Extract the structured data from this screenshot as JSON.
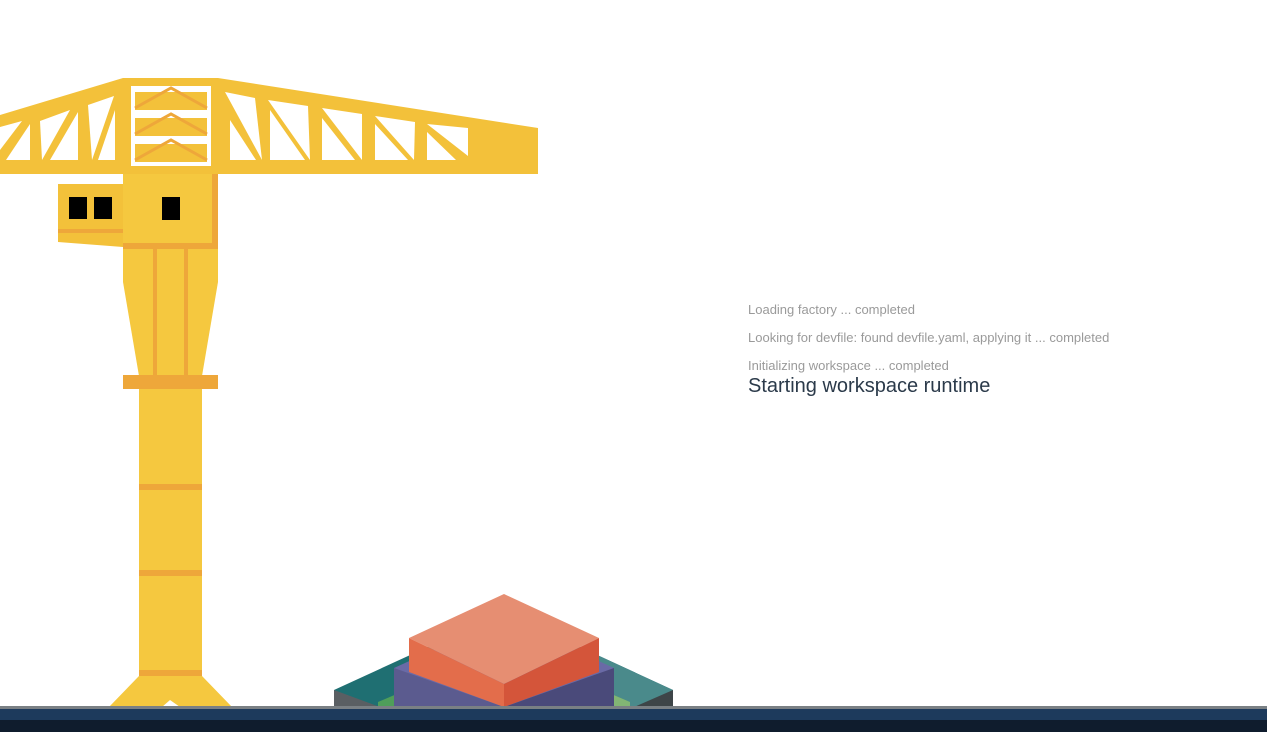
{
  "progress": {
    "completed_steps": [
      "Loading factory ... completed",
      "Looking for devfile: found devfile.yaml, applying it ... completed",
      "Initializing workspace ... completed"
    ],
    "current_step": "Starting workspace runtime"
  },
  "illustration": {
    "crane_icon": "crane-illustration",
    "containers_icon": "stacked-containers-illustration"
  },
  "colors": {
    "crane_yellow": "#f3c13a",
    "crane_orange": "#eea73a",
    "text_muted": "#9a9a9a",
    "text_current": "#2b3a4a",
    "floor_dark": "#0f1c2d",
    "floor_blue": "#1d3a5c"
  }
}
